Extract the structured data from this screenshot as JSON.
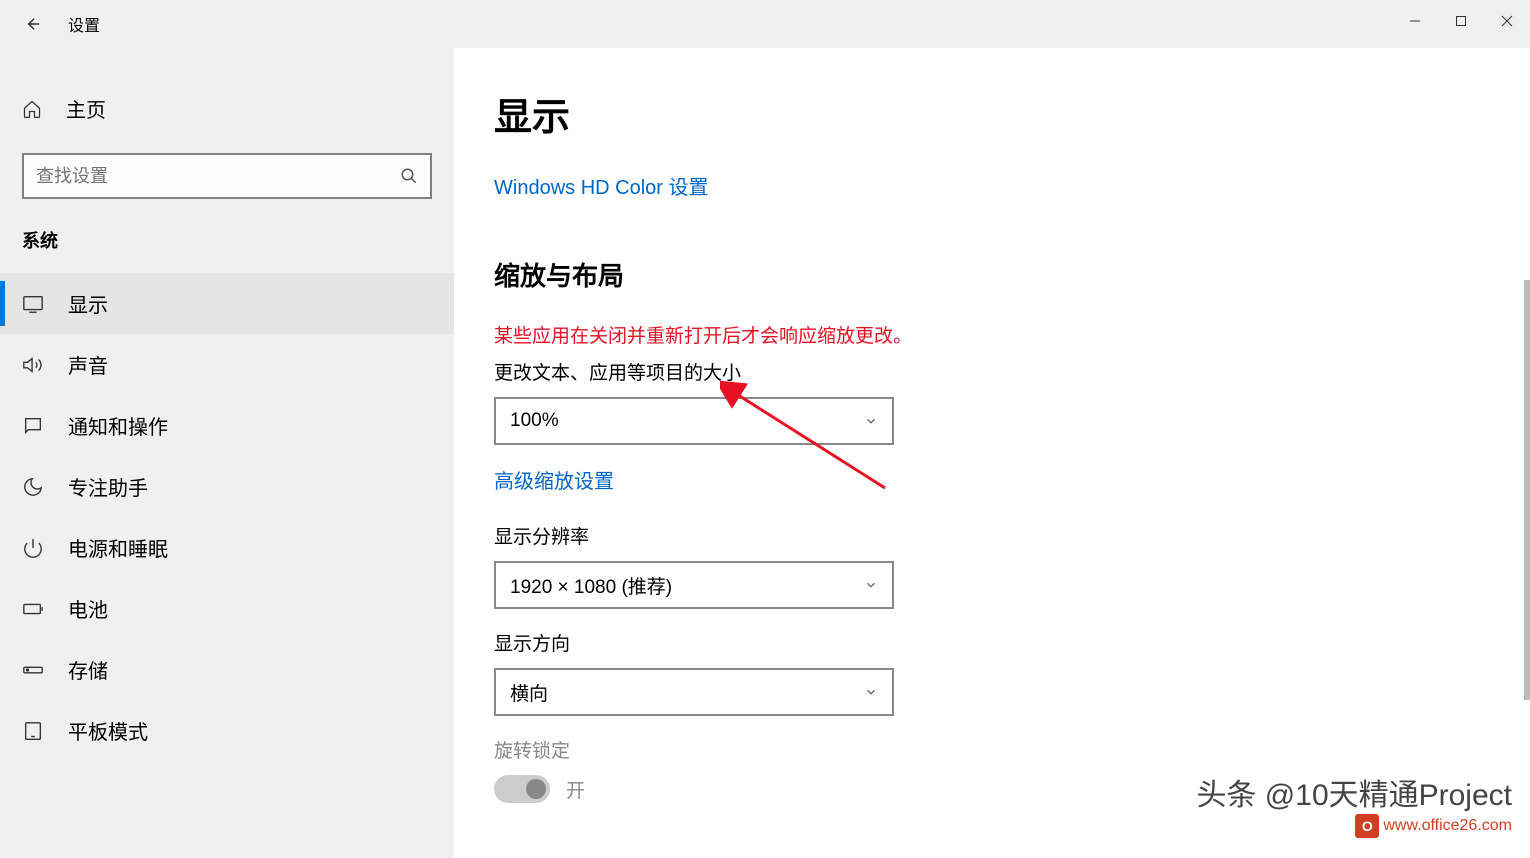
{
  "window": {
    "title": "设置",
    "controls": {
      "minimize": "—",
      "maximize": "□",
      "close": "✕"
    }
  },
  "sidebar": {
    "home_label": "主页",
    "search_placeholder": "查找设置",
    "section_label": "系统",
    "items": [
      {
        "icon": "display-icon",
        "label": "显示",
        "active": true
      },
      {
        "icon": "sound-icon",
        "label": "声音",
        "active": false
      },
      {
        "icon": "notifications-icon",
        "label": "通知和操作",
        "active": false
      },
      {
        "icon": "focus-icon",
        "label": "专注助手",
        "active": false
      },
      {
        "icon": "power-icon",
        "label": "电源和睡眠",
        "active": false
      },
      {
        "icon": "battery-icon",
        "label": "电池",
        "active": false
      },
      {
        "icon": "storage-icon",
        "label": "存储",
        "active": false
      },
      {
        "icon": "tablet-icon",
        "label": "平板模式",
        "active": false
      }
    ]
  },
  "content": {
    "page_title": "显示",
    "hd_color_link": "Windows HD Color 设置",
    "section_heading": "缩放与布局",
    "warning": "某些应用在关闭并重新打开后才会响应缩放更改。",
    "scale_label": "更改文本、应用等项目的大小",
    "scale_value": "100%",
    "advanced_link": "高级缩放设置",
    "resolution_label": "显示分辨率",
    "resolution_value": "1920 × 1080 (推荐)",
    "orientation_label": "显示方向",
    "orientation_value": "横向",
    "rotation_lock_label": "旋转锁定",
    "rotation_lock_state": "开"
  },
  "watermark": {
    "line1": "头条 @10天精通Project",
    "line2": "www.office26.com",
    "badge_text": "O"
  }
}
